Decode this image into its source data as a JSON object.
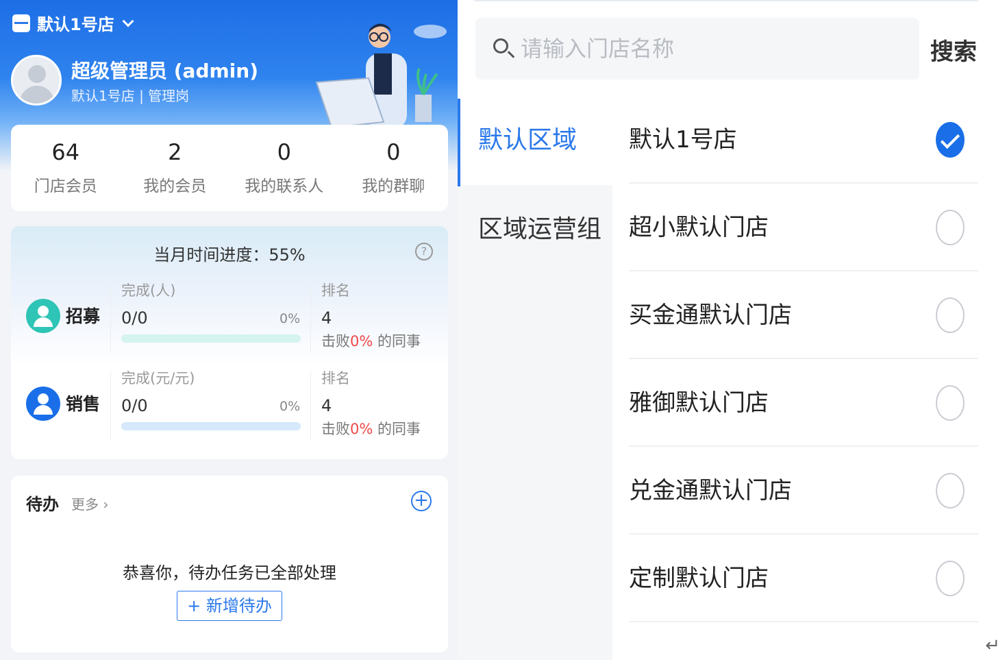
{
  "header": {
    "store_name": "默认1号店",
    "user_name": "超级管理员 (admin)",
    "user_sub": "默认1号店 | 管理岗"
  },
  "stats": [
    {
      "value": "64",
      "label": "门店会员"
    },
    {
      "value": "2",
      "label": "我的会员"
    },
    {
      "value": "0",
      "label": "我的联系人"
    },
    {
      "value": "0",
      "label": "我的群聊"
    }
  ],
  "progress": {
    "title": "当月时间进度：55%",
    "help": "?",
    "recruit": {
      "name": "招募",
      "sub_label": "完成(人)",
      "value": "0/0",
      "percent": "0%",
      "percent_value": 0,
      "rank_label": "排名",
      "rank": "4",
      "beat_prefix": "击败",
      "beat_pct": "0%",
      "beat_suffix": " 的同事",
      "color": "#2ec4b6"
    },
    "sales": {
      "name": "销售",
      "sub_label": "完成(元/元)",
      "value": "0/0",
      "percent": "0%",
      "percent_value": 0,
      "rank_label": "排名",
      "rank": "4",
      "beat_prefix": "击败",
      "beat_pct": "0%",
      "beat_suffix": " 的同事",
      "color": "#1a6fe8"
    }
  },
  "todo": {
    "title": "待办",
    "more": "更多 ›",
    "add_icon": "+",
    "empty_text": "恭喜你，待办任务已全部处理",
    "new_button": "+ 新增待办"
  },
  "search": {
    "placeholder": "请输入门店名称",
    "button": "搜索"
  },
  "regions": [
    {
      "label": "默认区域",
      "active": true
    },
    {
      "label": "区域运营组",
      "active": false
    }
  ],
  "stores": [
    {
      "name": "默认1号店",
      "checked": true
    },
    {
      "name": "超小默认门店",
      "checked": false
    },
    {
      "name": "买金通默认门店",
      "checked": false
    },
    {
      "name": "雅御默认门店",
      "checked": false
    },
    {
      "name": "兑金通默认门店",
      "checked": false
    },
    {
      "name": "定制默认门店",
      "checked": false
    }
  ],
  "misc": {
    "enter_glyph": "↵"
  },
  "colors": {
    "primary": "#1a6fe8",
    "accent_red": "#f04848",
    "recruit": "#2ec4b6"
  }
}
